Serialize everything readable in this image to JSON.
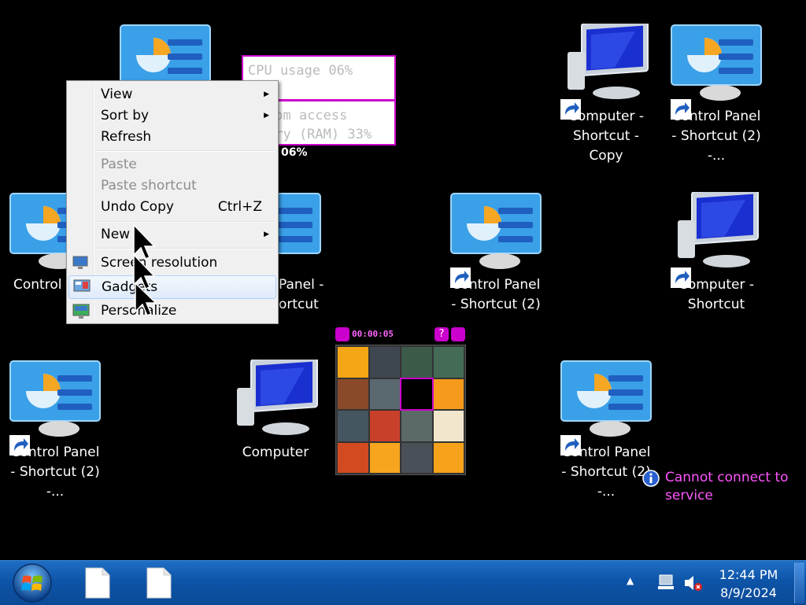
{
  "desktop": {
    "icons": [
      {
        "label": "Computer - Shortcut - Copy"
      },
      {
        "label": "Control Panel - Shortcut (2) -..."
      },
      {
        "label": "Control P"
      },
      {
        "label": "Panel - ortcut"
      },
      {
        "label": "Control Panel - Shortcut (2)"
      },
      {
        "label": "Computer - Shortcut"
      },
      {
        "label": "Control Panel - Shortcut (2) -..."
      },
      {
        "label": "Computer"
      },
      {
        "label": "Control Panel - Shortcut (2) -..."
      }
    ]
  },
  "cpu_gadget": {
    "cpu_label": "CPU usage 06%",
    "ram_line1": "dom access",
    "ram_line2": "ory (RAM) 33%",
    "cpu_percent_overlay": "06%"
  },
  "context_menu": {
    "items": [
      {
        "label": "View",
        "submenu": true
      },
      {
        "label": "Sort by",
        "submenu": true
      },
      {
        "label": "Refresh"
      },
      {
        "label": "Paste",
        "disabled": true
      },
      {
        "label": "Paste shortcut",
        "disabled": true
      },
      {
        "label": "Undo Copy",
        "shortcut": "Ctrl+Z"
      },
      {
        "label": "New",
        "submenu": true
      },
      {
        "label": "Screen resolution"
      },
      {
        "label": "Gadgets"
      },
      {
        "label": "Personalize"
      }
    ]
  },
  "puzzle": {
    "timer": "00:00:05",
    "help_glyph": "?",
    "tile_colors": [
      "#f4a614",
      "#3e4750",
      "#3c5a48",
      "#446b55",
      "#8a4a2a",
      "#5a6870",
      "#000000",
      "#f59a1a",
      "#465660",
      "#c9402a",
      "#5b6a66",
      "#f2e6cc",
      "#d24a20",
      "#f7a51e",
      "#4a5058",
      "#f6a21a"
    ]
  },
  "notice": {
    "text": "Cannot connect to service"
  },
  "taskbar": {
    "time": "12:44 PM",
    "date": "8/9/2024"
  },
  "colors": {
    "taskbar": "#0d54a8",
    "gadget_accent": "#cc00cc",
    "notice": "#ff55ff"
  }
}
